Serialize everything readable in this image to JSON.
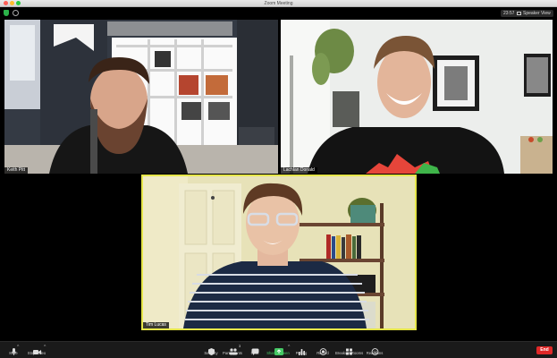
{
  "window": {
    "title": "Zoom Meeting"
  },
  "topbar": {
    "timer": "23:57",
    "view_label": "Speaker View"
  },
  "participants": [
    {
      "name": "Keith Pitt"
    },
    {
      "name": "Lachlan Donald"
    },
    {
      "name": "Tim Lucas"
    }
  ],
  "toolbar": {
    "mute": "Mute",
    "stop_video": "Stop Video",
    "security": "Security",
    "participants": "Participants",
    "participants_count": "3",
    "chat": "Chat",
    "share_screen": "Share Screen",
    "polling": "Polling",
    "record": "Record",
    "breakout_rooms": "Breakout Rooms",
    "reactions": "Reactions",
    "end": "End"
  },
  "colors": {
    "active_speaker_border": "#e6e64a",
    "share_green": "#44c864",
    "end_red": "#e02828"
  }
}
